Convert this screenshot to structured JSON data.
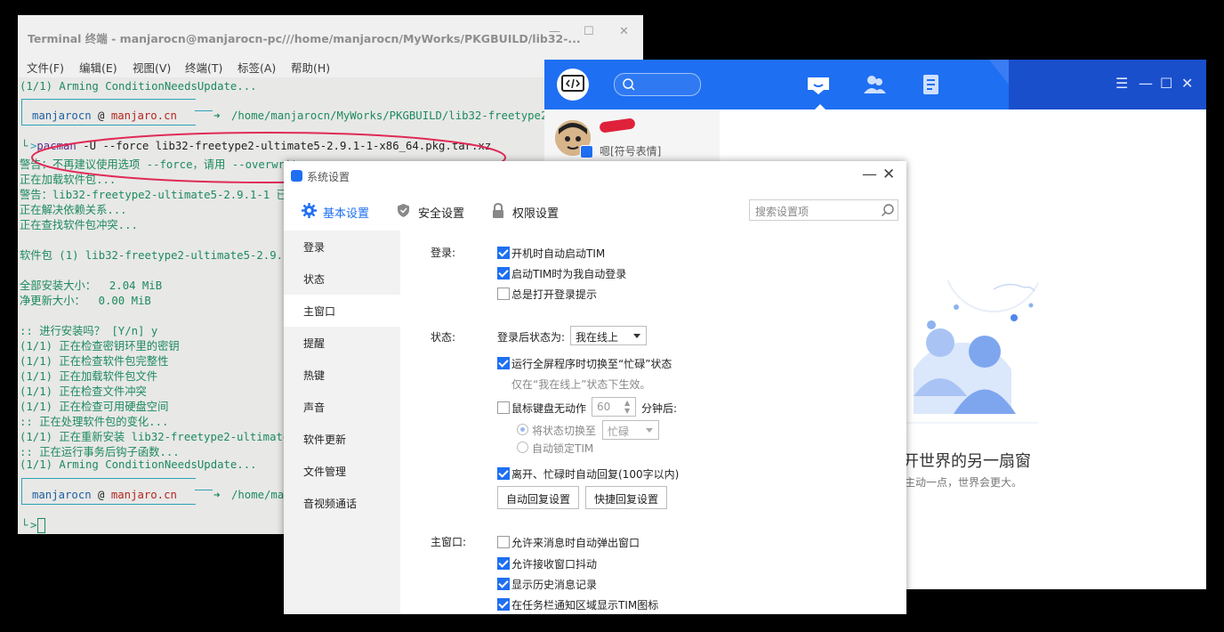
{
  "terminal": {
    "title": "Terminal 终端 - manjarocn@manjarocn-pc///home/manjarocn/MyWorks/PKGBUILD/lib32-...",
    "menu": [
      "文件(F)",
      "编辑(E)",
      "视图(V)",
      "终端(T)",
      "标签(A)",
      "帮助(H)"
    ],
    "prompt_user": "manjarocn",
    "prompt_at": "@",
    "prompt_host": "manjaro.cn",
    "prompt_path1": "/home/manjarocn/MyWorks/PKGBUILD/lib32-freetype2-ult",
    "prompt_path2": "/home/manj",
    "command_prog": "pacman",
    "command_args": " -U --force lib32-freetype2-ultimate5-2.9.1-1-x86_64.pkg.tar.xz",
    "lines_top": [
      "(1/1) Arming ConditionNeedsUpdate..."
    ],
    "lines_output": [
      "警告：不再建议使用选项 --force，请用 --overwrite",
      "正在加载软件包...",
      "警告：lib32-freetype2-ultimate5-2.9.1-1 已经",
      "正在解决依赖关系...",
      "正在查找软件包冲突...",
      "",
      "软件包 (1) lib32-freetype2-ultimate5-2.9.1-",
      "",
      "全部安装大小：  2.04 MiB",
      "净更新大小：  0.00 MiB",
      "",
      ":: 进行安装吗？ [Y/n] y",
      "(1/1) 正在检查密钥环里的密钥",
      "(1/1) 正在检查软件包完整性",
      "(1/1) 正在加载软件包文件",
      "(1/1) 正在检查文件冲突",
      "(1/1) 正在检查可用硬盘空间",
      ":: 正在处理软件包的变化...",
      "(1/1) 正在重新安装 lib32-freetype2-ultimate",
      ":: 正在运行事务后钩子函数...",
      "(1/1) Arming ConditionNeedsUpdate..."
    ]
  },
  "tim": {
    "status_text": "嗯[符号表情]",
    "slogan": "开世界的另一扇窗",
    "slogan_sub": "主动一点，世界会更大。"
  },
  "settings": {
    "title": "系统设置",
    "tabs": [
      "基本设置",
      "安全设置",
      "权限设置"
    ],
    "search_placeholder": "搜索设置项",
    "left_items": [
      "登录",
      "状态",
      "主窗口",
      "提醒",
      "热键",
      "声音",
      "软件更新",
      "文件管理",
      "音视频通话"
    ],
    "login": {
      "label": "登录:",
      "opt1": "开机时自动启动TIM",
      "opt2": "启动TIM时为我自动登录",
      "opt3": "总是打开登录提示"
    },
    "status": {
      "label": "状态:",
      "after_login": "登录后状态为:",
      "after_login_value": "我在线上",
      "fullscreen": "运行全屏程序时切换至“忙碌”状态",
      "fullscreen_hint": "仅在“我在线上”状态下生效。",
      "idle": "鼠标键盘无动作",
      "idle_value": "60",
      "idle_after": "分钟后:",
      "switch_to": "将状态切换至",
      "switch_value": "忙碌",
      "auto_lock": "自动锁定TIM",
      "auto_reply": "离开、忙碌时自动回复(100字以内)",
      "btn_auto_reply": "自动回复设置",
      "btn_quick_reply": "快捷回复设置"
    },
    "main_window": {
      "label": "主窗口:",
      "opt1": "允许来消息时自动弹出窗口",
      "opt2": "允许接收窗口抖动",
      "opt3": "显示历史消息记录",
      "opt4": "在任务栏通知区域显示TIM图标"
    }
  }
}
